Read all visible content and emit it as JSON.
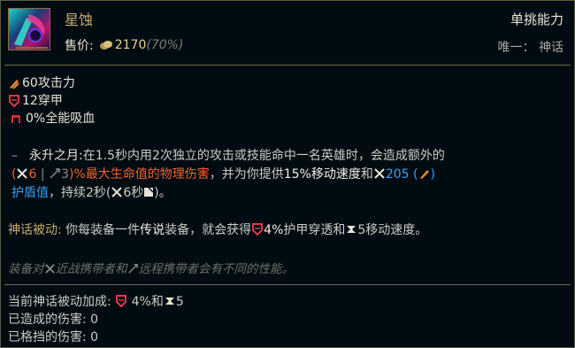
{
  "item": {
    "name": "星蚀",
    "price_label": "售价:",
    "price": "2170",
    "price_pct": "(70%)",
    "category": "单挑能力",
    "unique": "唯一：  神话"
  },
  "stats": [
    {
      "icon": "attack-damage-icon",
      "text": "60攻击力"
    },
    {
      "icon": "armor-pen-icon",
      "text": "12穿甲"
    },
    {
      "icon": "omnivamp-icon",
      "text": "0%全能吸血"
    }
  ],
  "passive": {
    "dash": "–",
    "name": "永升之月:",
    "t1": "在1.5秒内用2次独立的攻击或技能命中一名英雄时，会造成额外的",
    "open": "(",
    "melee": "6",
    "sep": " | ",
    "ranged": "3",
    "close": ")",
    "dmg": "%最大生命值的物理伤害",
    "t2": "，并为你提供",
    "ms": "15%移动速度",
    "t3": "和",
    "shield_val": "205",
    "shield_open": " (",
    "shield_close": ")",
    "shield": "护盾值",
    "t4": "，持续2秒(",
    "melee_dur": "6秒",
    "t5": ")。"
  },
  "mythic": {
    "label": "神话被动:",
    "t1": "你每装备一件",
    "legend": "传说",
    "t2": "装备，就会获得",
    "armorpen": "4%",
    "t3": "护甲穿透和",
    "ms": "5移动速度。"
  },
  "note": {
    "t1": "装备对",
    "melee": "近战携带者和",
    "ranged": "远程携带者会有不同的性能。"
  },
  "bottom": {
    "bonus_label": "当前神话被动加成:",
    "bonus_a": " 4%和",
    "bonus_b": "5",
    "dealt_label": "已造成的伤害:",
    "dealt": "0",
    "blocked_label": "已格挡的伤害:",
    "blocked": "0"
  },
  "colors": {
    "gold": "#c8aa6e",
    "orange": "#f0642e",
    "blue": "#3aa0f0",
    "background": "#010c12"
  }
}
